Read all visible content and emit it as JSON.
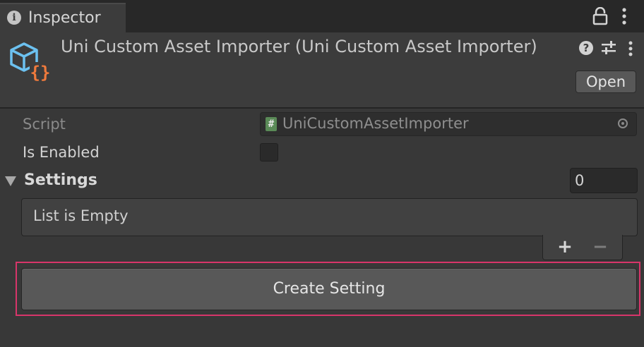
{
  "tab": {
    "title": "Inspector",
    "info_glyph": "i",
    "icons": [
      "info-icon",
      "lock-icon",
      "kebab-menu-icon"
    ]
  },
  "header": {
    "title": "Uni Custom Asset Importer (Uni Custom Asset Importer)",
    "help_glyph": "?",
    "open_label": "Open",
    "icons": [
      "script-asset-icon",
      "help-icon",
      "presets-icon",
      "kebab-menu-icon"
    ]
  },
  "fields": {
    "script_label": "Script",
    "script_icon_glyph": "#",
    "script_value": "UniCustomAssetImporter",
    "is_enabled_label": "Is Enabled",
    "is_enabled_checked": false
  },
  "settings": {
    "label": "Settings",
    "count": "0",
    "empty_text": "List is Empty",
    "add_glyph": "+",
    "remove_glyph": "−"
  },
  "actions": {
    "create_label": "Create Setting"
  },
  "colors": {
    "background": "#383838",
    "highlight": "#d8356a",
    "asset_icon_cube": "#6cc1f0",
    "asset_icon_braces": "#f07a3c"
  }
}
